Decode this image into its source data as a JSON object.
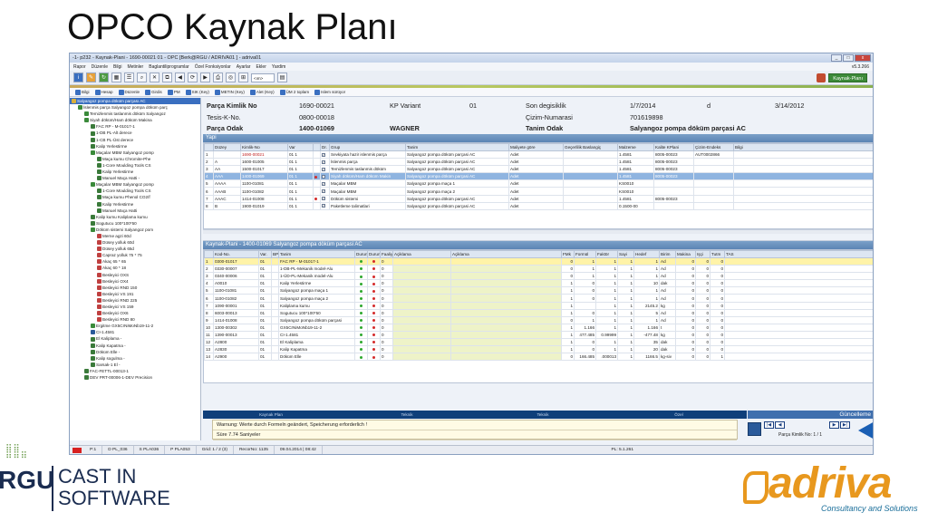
{
  "slide_title": "OPCO Kaynak Planı",
  "window": {
    "title": "-1- p232 - Kaynak-Plani - 1690-00021  01 -    OPC [Berk@RGU / ADRIVA01 ] -  adriva01",
    "controls": [
      "_",
      "□",
      "x"
    ]
  },
  "menu": {
    "items": [
      "Rapor",
      "Düzenle",
      "Bilgi",
      "Metinler",
      "Baglantiliprogramlar",
      "Özel Fonksiyonlar",
      "Ayarlar",
      "Ekler",
      "Yardim"
    ],
    "version": "v5.3.266"
  },
  "toolbar": {
    "select_value": "<ım>",
    "kaynak_button": "Kaynak-Planı"
  },
  "subtoolbar": {
    "items": [
      "Bilgi",
      "Hesap",
      "Düzenle",
      "Girdis",
      "PM",
      "SIK (Key)",
      "METIN (Key)",
      "Alet (Key)",
      "ÜM 2 toplam",
      "Islem sürüyor"
    ]
  },
  "tree": {
    "items": [
      {
        "text": "Salyangoz pompa döküm parçası AC",
        "indent": 0,
        "color": "#d9b03a",
        "selected": true
      },
      {
        "text": "İslenmis parça Salyangoz pompa döküm parç",
        "indent": 1,
        "color": "#3a8a3a"
      },
      {
        "text": "Temizlenmis taslanmis döküm Salyangoz",
        "indent": 2,
        "color": "#3a8a3a"
      },
      {
        "text": "Siyah döküm/Ham döküm Makina",
        "indent": 2,
        "color": "#3a8a3a"
      },
      {
        "text": "FAC RP - M-01017-1",
        "indent": 3,
        "color": "#3a7a3a"
      },
      {
        "text": "1-DB PL-Alt derece",
        "indent": 3,
        "color": "#3a7a3a"
      },
      {
        "text": "1-CB PL-Üst derece",
        "indent": 3,
        "color": "#3a7a3a"
      },
      {
        "text": "Kalip Yerlestirme",
        "indent": 3,
        "color": "#3a7a3a"
      },
      {
        "text": "Maçalar MBM Salyangoz pomp",
        "indent": 3,
        "color": "#3a8a3a"
      },
      {
        "text": "Maça kumu Chromite-Phe",
        "indent": 4,
        "color": "#3a7a3a"
      },
      {
        "text": "1-Core Moulding Tools CS",
        "indent": 4,
        "color": "#3a7a3a"
      },
      {
        "text": "Kalip Yerlestirme",
        "indent": 4,
        "color": "#3a7a3a"
      },
      {
        "text": "Manuel Maça Hatti -",
        "indent": 4,
        "color": "#3a7a3a"
      },
      {
        "text": "Maçalar MBM Salyangoz pomp",
        "indent": 3,
        "color": "#3a8a3a"
      },
      {
        "text": "1-Core Moulding Tools CS",
        "indent": 4,
        "color": "#3a7a3a"
      },
      {
        "text": "Maça kumu Phenol CO2/f",
        "indent": 4,
        "color": "#3a7a3a"
      },
      {
        "text": "Kalip Yerlestirme",
        "indent": 4,
        "color": "#3a7a3a"
      },
      {
        "text": "Manuel Maça Hatti",
        "indent": 4,
        "color": "#3a7a3a"
      },
      {
        "text": "Kalip kumu Kaliplama kumu",
        "indent": 3,
        "color": "#3a7a3a"
      },
      {
        "text": "Sogutucu 100*100*50",
        "indent": 3,
        "color": "#3a7a3a"
      },
      {
        "text": "Döküm sistemi Salyangoz pom",
        "indent": 3,
        "color": "#3a8a3a"
      },
      {
        "text": "Merne agzi 60d",
        "indent": 4,
        "color": "#c04040"
      },
      {
        "text": "Düsey yolluk 60d",
        "indent": 4,
        "color": "#c04040"
      },
      {
        "text": "Düsey yolluk 65d",
        "indent": 4,
        "color": "#c04040"
      },
      {
        "text": "Capraz yolluk 75 * 75",
        "indent": 4,
        "color": "#c04040"
      },
      {
        "text": "Akaç 65 * 65",
        "indent": 4,
        "color": "#c04040"
      },
      {
        "text": "Akaç 60 * 18",
        "indent": 4,
        "color": "#c04040"
      },
      {
        "text": "Besleyici OXS",
        "indent": 4,
        "color": "#c04040"
      },
      {
        "text": "Besleyici OX4",
        "indent": 4,
        "color": "#c04040"
      },
      {
        "text": "Besleyici RND 150",
        "indent": 4,
        "color": "#c04040"
      },
      {
        "text": "Besleyici VS 191",
        "indent": 4,
        "color": "#c04040"
      },
      {
        "text": "Besleyici RND 225",
        "indent": 4,
        "color": "#c04040"
      },
      {
        "text": "Besleyici VS 159",
        "indent": 4,
        "color": "#c04040"
      },
      {
        "text": "Besleyici OX6",
        "indent": 4,
        "color": "#c04040"
      },
      {
        "text": "Besleyici RND 80",
        "indent": 4,
        "color": "#c04040"
      },
      {
        "text": "Ergitme GX5CrNiMoNb19-11-2",
        "indent": 3,
        "color": "#3a8a3a"
      },
      {
        "text": "CI-1.4581",
        "indent": 3,
        "color": "#2a5a9a"
      },
      {
        "text": "El Kaliplama -",
        "indent": 3,
        "color": "#3a7a3a"
      },
      {
        "text": "Kalip Kapatma -",
        "indent": 3,
        "color": "#3a7a3a"
      },
      {
        "text": "Döküm Elle -",
        "indent": 3,
        "color": "#3a7a3a"
      },
      {
        "text": "Kalip sogulma -",
        "indent": 3,
        "color": "#3a7a3a"
      },
      {
        "text": "Sarsak-1 El -",
        "indent": 3,
        "color": "#3a7a3a"
      },
      {
        "text": "FAC-FETTL-00013-1",
        "indent": 2,
        "color": "#3a7a3a"
      },
      {
        "text": "DEV PRT-00006-1-DEV Precision",
        "indent": 2,
        "color": "#3a7a3a"
      }
    ]
  },
  "header": {
    "parca_kimlik_label": "Parça Kimlik No",
    "parca_kimlik_value": "1690-00021",
    "kp_variant_label": "KP Variant",
    "kp_variant_value": "01",
    "son_degisiklik_label": "Son degisiklik",
    "son_degisiklik_value": "1/7/2014",
    "d_value": "d",
    "date2": "3/14/2012",
    "tesis_label": "Tesis-K-No.",
    "tesis_value": "0800-00018",
    "cizim_label": "Çizim-Numarasi",
    "cizim_value": "701619898",
    "parca_odak_label": "Parça Odak",
    "parca_odak_value": "1400-01069",
    "user": "WAGNER",
    "tanim_odak_label": "Tanim Odak",
    "tanim_odak_value": "Salyangoz pompa döküm parçasi AC"
  },
  "yapi": {
    "title": "Yapi",
    "columns": [
      "",
      "Düzey",
      "Kimlik-No",
      "Var",
      "",
      "Dr.",
      "Grup",
      "Tanim",
      "Maliyete göre",
      "Geçerlilik Baslangiç",
      "Malzeme",
      "Kalite KPlani",
      "Çizim-Endeks",
      "Bilgi"
    ],
    "rows": [
      [
        "1",
        "",
        "1690-00021",
        "01  1",
        "",
        "✓",
        "Sevkiyata hazir islenmis parça",
        "Salyangoz pompa döküm parçasi AC",
        "Adet",
        "",
        "1.4581",
        "8005-00023",
        "AUT0002866",
        ""
      ],
      [
        "2",
        "A",
        "1600-01005",
        "01  1",
        "",
        "✓",
        "İslenmis parça",
        "Salyangoz pompa döküm parçasi AC",
        "Adet",
        "",
        "1.4581",
        "8005-00023",
        "",
        ""
      ],
      [
        "3",
        "AA",
        "1500-01017",
        "01  1",
        "",
        "✓",
        "Temizlenmis taslanmis döküm",
        "Salyangoz pompa döküm parçasi AC",
        "Adet",
        "",
        "1.4581",
        "8005-00023",
        "",
        ""
      ],
      [
        "4",
        "AAA",
        "1400-01069",
        "01  1",
        "●",
        "✓",
        "Siyah döküm/Ham döküm Makin",
        "Salyangoz pompa döküm parçasi AC",
        "Adet",
        "",
        "1.4581",
        "8005-00023",
        "",
        ""
      ],
      [
        "5",
        "AAAA",
        "1100-01081",
        "01  1",
        "",
        "✓",
        "Maçalar MBM",
        "Salyangoz pompa maça 1",
        "Adet",
        "",
        "KS0010",
        "",
        "",
        ""
      ],
      [
        "6",
        "AAAB",
        "1100-01082",
        "01  1",
        "",
        "✓",
        "Maçalar MBM",
        "Salyangoz pompa maça 2",
        "Adet",
        "",
        "KS0010",
        "",
        "",
        ""
      ],
      [
        "7",
        "AAAC",
        "1414-01008",
        "01  1",
        "●",
        "✓",
        "Döküm sistemi",
        "Salyangoz pompa döküm parçasi AC",
        "Adet",
        "",
        "1.4581",
        "8005-00023",
        "",
        ""
      ],
      [
        "8",
        "B",
        "1900-01019",
        "01  1",
        "",
        "✓",
        "Paketleme talimatlari",
        "Salyangoz pompa döküm parçasi AC",
        "Adet",
        "",
        "0.1500-00",
        "",
        "",
        ""
      ]
    ]
  },
  "kaynak": {
    "title": "Kaynak-Plani - 1400-01069   Salyangoz pompa döküm parçasi AC",
    "columns": [
      "",
      "Kod-No.",
      "Var.",
      "BPt",
      "Tanim",
      "Durun",
      "Durun",
      "Faaliy",
      "Açiklama",
      "Açiklama",
      "FMk",
      "Formül",
      "Faktör",
      "Sayi",
      "Hedef",
      "Birim",
      "Makina",
      "Işçi",
      "Tutm",
      "TAS"
    ],
    "rows": [
      [
        "1",
        "0300-01017",
        "01",
        "",
        "FAC RP - M-01017-1",
        "g",
        "r",
        "0",
        "",
        "",
        "0",
        "1",
        "1",
        "1",
        "1",
        "Ad",
        "0",
        "0",
        "0",
        ""
      ],
      [
        "2",
        "0330-00007",
        "01",
        "",
        "1-DB-PL-Mekanik model-Alu",
        "g",
        "r",
        "0",
        "",
        "",
        "0",
        "1",
        "1",
        "1",
        "1",
        "Ad",
        "0",
        "0",
        "0",
        ""
      ],
      [
        "3",
        "0340-00006",
        "01",
        "",
        "1-ÜD-PL-Mekanik model-Alu",
        "g",
        "r",
        "0",
        "",
        "",
        "0",
        "1",
        "1",
        "1",
        "1",
        "Ad",
        "0",
        "0",
        "0",
        ""
      ],
      [
        "4",
        "A0010",
        "01",
        "",
        "Kalip Yerlestirme",
        "g",
        "r",
        "0",
        "",
        "",
        "1",
        "0",
        "1",
        "1",
        "10",
        "dak",
        "0",
        "0",
        "0",
        ""
      ],
      [
        "5",
        "1100-01081",
        "01",
        "",
        "Salyangoz pompa maça 1",
        "g",
        "r",
        "0",
        "",
        "",
        "1",
        "0",
        "1",
        "1",
        "1",
        "Ad",
        "0",
        "0",
        "0",
        ""
      ],
      [
        "6",
        "1100-01082",
        "01",
        "",
        "Salyangoz pompa maça 2",
        "g",
        "r",
        "0",
        "",
        "",
        "1",
        "0",
        "1",
        "1",
        "1",
        "Ad",
        "0",
        "0",
        "0",
        ""
      ],
      [
        "7",
        "1090-00001",
        "01",
        "",
        "Kaliplama kumu",
        "g",
        "r",
        "0",
        "",
        "",
        "1",
        "",
        "1",
        "1",
        "2145.2",
        "kg",
        "0",
        "0",
        "0",
        ""
      ],
      [
        "8",
        "6003-00013",
        "01",
        "",
        "Sogutucu 100*100*50",
        "g",
        "r",
        "0",
        "",
        "",
        "1",
        "0",
        "1",
        "1",
        "5",
        "Ad",
        "0",
        "0",
        "0",
        ""
      ],
      [
        "9",
        "1414-01008",
        "01",
        "",
        "Salyangoz pompa döküm parçasi",
        "g",
        "r",
        "0",
        "",
        "",
        "0",
        "1",
        "1",
        "1",
        "1",
        "Ad",
        "0",
        "0",
        "0",
        ""
      ],
      [
        "10",
        "1300-00302",
        "01",
        "",
        "GX5CrNiMoNb19-11-2",
        "g",
        "r",
        "0",
        "",
        "",
        "1",
        "1.166",
        "1",
        "1",
        "1.166",
        "t",
        "0",
        "0",
        "0",
        ""
      ],
      [
        "11",
        "1390-00013",
        "01",
        "",
        "CI-1.4581",
        "g",
        "r",
        "0",
        "",
        "",
        "1",
        "477.485",
        "0.99999",
        "1",
        "-477.48",
        "kg",
        "0",
        "0",
        "0",
        ""
      ],
      [
        "12",
        "A2800",
        "01",
        "",
        "El Kaliplama",
        "g",
        "r",
        "0",
        "",
        "",
        "1",
        "0",
        "1",
        "1",
        "35",
        "dak",
        "0",
        "0",
        "0",
        ""
      ],
      [
        "13",
        "A2830",
        "01",
        "",
        "Kalip Kapatma",
        "g",
        "r",
        "0",
        "",
        "",
        "1",
        "0",
        "1",
        "1",
        "20",
        "dak",
        "0",
        "0",
        "0",
        ""
      ],
      [
        "14",
        "A2900",
        "01",
        "",
        "Döküm Elle",
        "g",
        "r",
        "0",
        "",
        "",
        "0",
        "166.485",
        ".000013",
        "1",
        "1166.5",
        "kg-siv",
        "0",
        "0",
        "1",
        ""
      ]
    ]
  },
  "bottom": {
    "tabs": [
      "Kaynak Plan",
      "Teknik",
      "Teknik",
      "Özel"
    ],
    "guncelleme": "Güncelleme",
    "message1": "Warnung: Werte durch Formeln geändert, Speicherung erforderlich !",
    "message2": "Süre 7.74 Saniyeler",
    "parca_kimlik_nav": "Parça Kimlik No:  1 / 1",
    "nav_buttons": [
      "|◀",
      "◀",
      "▶",
      "▶|"
    ]
  },
  "status": {
    "items": [
      "P:1",
      "D PL_036",
      "S PLA036",
      "P PLA053",
      "Grid: 1 / 2 (3)",
      "RecorNo: 1135",
      "09.04.2014 | 08:42",
      "PL: 5.1.261"
    ]
  },
  "logos": {
    "rgu_big": "RGU",
    "rgu_line1": "CAST IN",
    "rgu_line2": "SOFTWARE",
    "adriva_word": "adriva",
    "adriva_tag": "Consultancy and Solutions"
  },
  "colors": {
    "accent": "#5b84b4",
    "navy": "#0f3f7a",
    "adriva_orange": "#e8981e",
    "rgu_green": "#6a9a4a"
  }
}
